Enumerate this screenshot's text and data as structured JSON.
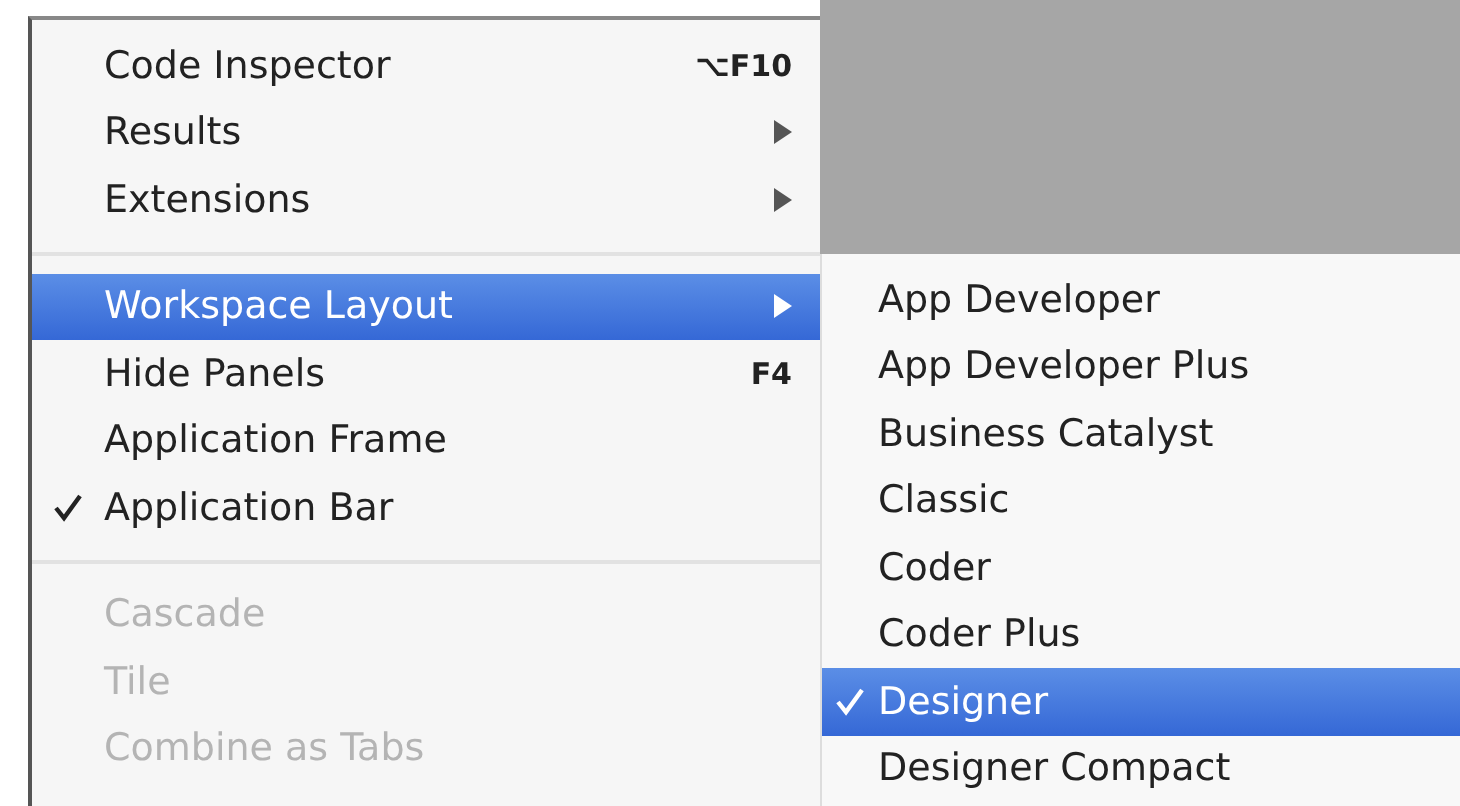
{
  "menu": {
    "groups": [
      {
        "items": [
          {
            "kind": "shortcut",
            "label": "Code Inspector",
            "shortcut": "⌥F10",
            "checked": false,
            "selected": false,
            "disabled": false
          },
          {
            "kind": "submenu",
            "label": "Results",
            "checked": false,
            "selected": false,
            "disabled": false
          },
          {
            "kind": "submenu",
            "label": "Extensions",
            "checked": false,
            "selected": false,
            "disabled": false
          }
        ]
      },
      {
        "items": [
          {
            "kind": "submenu",
            "label": "Workspace Layout",
            "checked": false,
            "selected": true,
            "disabled": false
          },
          {
            "kind": "shortcut",
            "label": "Hide Panels",
            "shortcut": "F4",
            "checked": false,
            "selected": false,
            "disabled": false
          },
          {
            "kind": "plain",
            "label": "Application Frame",
            "checked": false,
            "selected": false,
            "disabled": false
          },
          {
            "kind": "plain",
            "label": "Application Bar",
            "checked": true,
            "selected": false,
            "disabled": false
          }
        ]
      },
      {
        "items": [
          {
            "kind": "plain",
            "label": "Cascade",
            "checked": false,
            "selected": false,
            "disabled": true
          },
          {
            "kind": "plain",
            "label": "Tile",
            "checked": false,
            "selected": false,
            "disabled": true
          },
          {
            "kind": "plain",
            "label": "Combine as Tabs",
            "checked": false,
            "selected": false,
            "disabled": true
          }
        ]
      }
    ]
  },
  "submenu": {
    "items": [
      {
        "label": "App Developer",
        "checked": false,
        "selected": false
      },
      {
        "label": "App Developer Plus",
        "checked": false,
        "selected": false
      },
      {
        "label": "Business Catalyst",
        "checked": false,
        "selected": false
      },
      {
        "label": "Classic",
        "checked": false,
        "selected": false
      },
      {
        "label": "Coder",
        "checked": false,
        "selected": false
      },
      {
        "label": "Coder Plus",
        "checked": false,
        "selected": false
      },
      {
        "label": "Designer",
        "checked": true,
        "selected": true
      },
      {
        "label": "Designer Compact",
        "checked": false,
        "selected": false
      }
    ]
  }
}
